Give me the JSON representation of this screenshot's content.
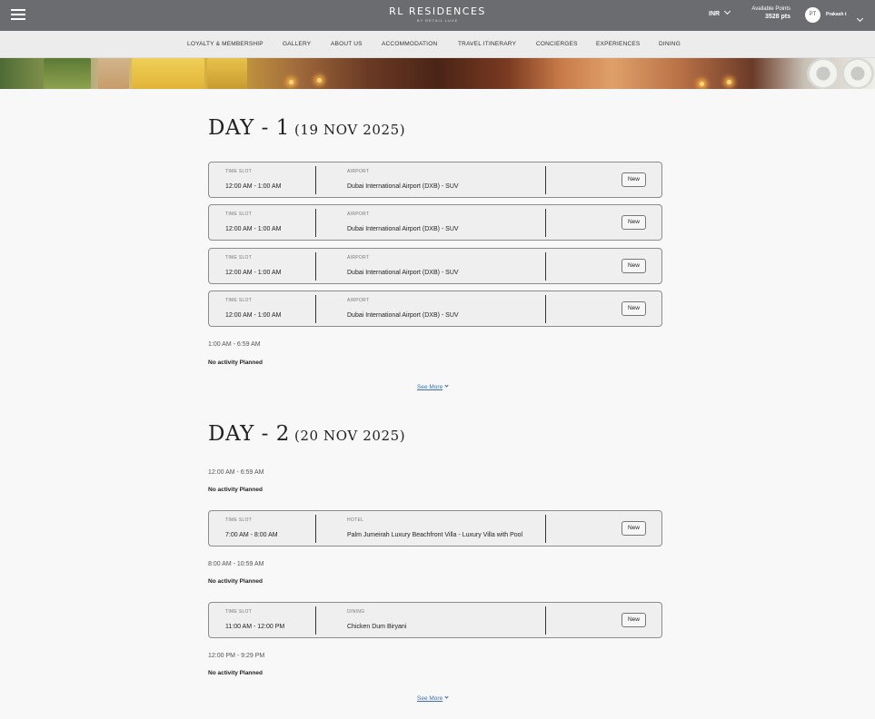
{
  "header": {
    "brand": "RL RESIDENCES",
    "brand_sub": "BY RETAIL LUXE",
    "currency": "INR",
    "points_label": "Available Points",
    "points_value": "3528 pts",
    "avatar_initials": "PT",
    "username": "Prakash t"
  },
  "nav": {
    "items": [
      "LOYALTY & MEMBERSHIP",
      "GALLERY",
      "ABOUT US",
      "ACCOMMODATION",
      "TRAVEL ITINERARY",
      "CONCIERGES",
      "EXPERIENCES",
      "DINING"
    ]
  },
  "labels": {
    "time_slot": "TIME SLOT",
    "new": "New",
    "see_more": "See More",
    "no_activity": "No activity Planned"
  },
  "days": [
    {
      "title": "DAY - 1",
      "date": "(19 NOV 2025)",
      "entries": [
        {
          "slot": "12:00 AM - 1:00 AM",
          "category": "AIRPORT",
          "place": "Dubai International Airport (DXB) - SUV"
        },
        {
          "slot": "12:00 AM - 1:00 AM",
          "category": "AIRPORT",
          "place": "Dubai International Airport (DXB) - SUV"
        },
        {
          "slot": "12:00 AM - 1:00 AM",
          "category": "AIRPORT",
          "place": "Dubai International Airport (DXB) - SUV"
        },
        {
          "slot": "12:00 AM - 1:00 AM",
          "category": "AIRPORT",
          "place": "Dubai International Airport (DXB) - SUV"
        }
      ],
      "gaps": [
        {
          "time": "1:00 AM - 6:59 AM"
        }
      ]
    },
    {
      "title": "DAY - 2",
      "date": "(20 NOV 2025)",
      "entries": [
        {
          "slot": "7:00 AM - 8:00 AM",
          "category": "HOTEL",
          "place": "Palm Jumeirah Luxury Beachfront Villa - Luxury Villa with Pool"
        },
        {
          "slot": "11:00 AM - 12:00 PM",
          "category": "DINING",
          "place": "Chicken Dum Biryani"
        }
      ],
      "gaps": [
        {
          "time": "12:00 AM - 6:59 AM"
        },
        {
          "time": "8:00 AM - 10:59 AM"
        },
        {
          "time": "12:00 PM - 9:29 PM"
        }
      ]
    }
  ]
}
